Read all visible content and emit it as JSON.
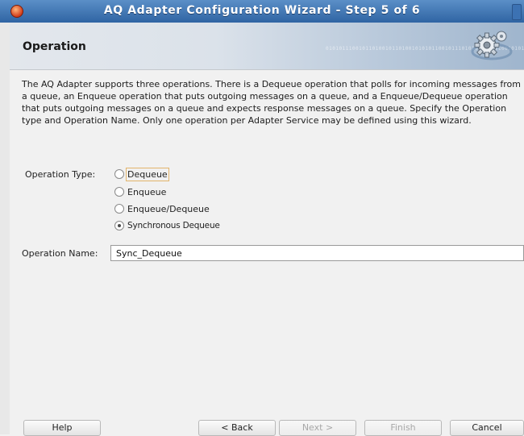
{
  "window": {
    "title": "AQ Adapter Configuration Wizard - Step 5 of 6"
  },
  "header": {
    "title": "Operation",
    "binary_text": "0101011100101101001011010010101011001011101010100101100101010110001011010"
  },
  "description": "The AQ Adapter supports three operations.  There is a Dequeue operation that polls for incoming messages from a queue, an Enqueue operation that puts outgoing messages on a queue, and a Enqueue/Dequeue operation that puts outgoing messages on a queue and expects response messages on a queue.  Specify the Operation type and Operation Name. Only one operation per Adapter Service may be defined using this wizard.",
  "operation_type": {
    "label": "Operation Type:",
    "options": [
      {
        "label": "Dequeue",
        "selected": false
      },
      {
        "label": "Enqueue",
        "selected": false
      },
      {
        "label": "Enqueue/Dequeue",
        "selected": false
      },
      {
        "label": "Synchronous Dequeue",
        "selected": true
      }
    ]
  },
  "operation_name": {
    "label": "Operation Name:",
    "value": "Sync_Dequeue"
  },
  "buttons": {
    "help": "Help",
    "back": "< Back",
    "next": "Next >",
    "finish": "Finish",
    "cancel": "Cancel"
  }
}
